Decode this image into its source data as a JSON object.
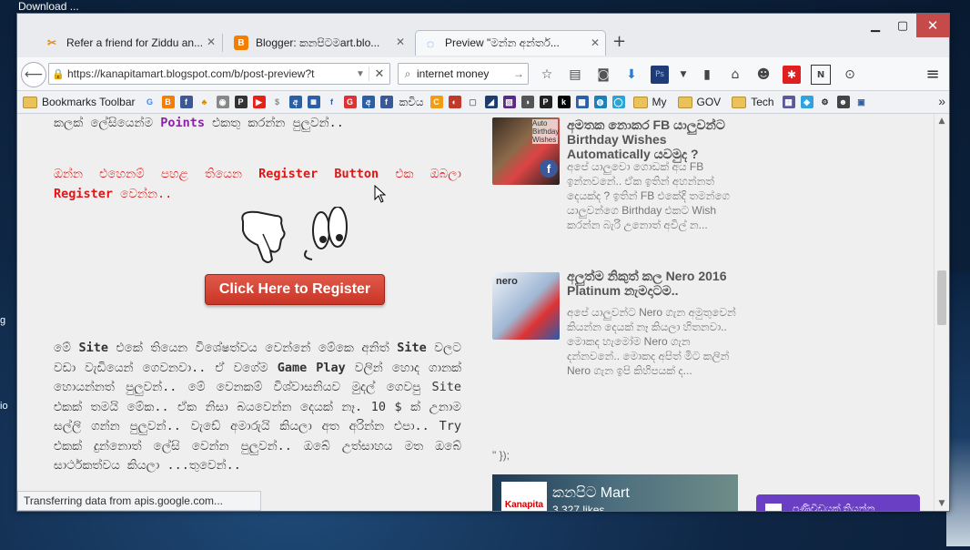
{
  "desktop": {
    "top_label": "Download ...",
    "side_labels": [
      "g",
      "io"
    ]
  },
  "tabs": [
    {
      "title": "Refer a friend for Ziddu an...",
      "icon": "ziddu-icon",
      "color": "#e28b1e",
      "active": false
    },
    {
      "title": "Blogger: කනපිටමart.blo...",
      "icon": "blogger-icon",
      "color": "#f57d00",
      "active": false
    },
    {
      "title": "Preview \"මන්න අන්තර්...",
      "icon": "loading-icon",
      "color": "#3a8be0",
      "active": true
    }
  ],
  "navbar": {
    "url": "https://kanapitamart.blogspot.com/b/post-preview?t",
    "search_value": "internet money"
  },
  "bookmarks": {
    "toolbar_label": "Bookmarks Toolbar",
    "text_items": [
      "කවිය",
      "My",
      "GOV",
      "Tech"
    ],
    "more": "»"
  },
  "post": {
    "line_points": "කලක් ලේසියෙන්ම ",
    "points_bold": "Points",
    "line_points_rest": " එකතු කරන්න පුලුවන්..",
    "red_line1_a": "ඔන්න එහෙනම් පහළ තියෙන ",
    "register_button_word": "Register Button",
    "red_line1_b": " එක ඔබලා ",
    "register_word": "Register",
    "red_line1_c": " වෙන්න..",
    "register_button_label": "Click Here to Register",
    "para_a": "මේ ",
    "site_bold": "Site",
    "para_b": " එකේ තියෙන විශේෂත්වය වෙන්නේ මේකෙ අනිත් ",
    "site_bold2": "Site",
    "para_c": " වලට වඩා වැඩියෙන් ගෙවනවා.. ඒ වගේම ",
    "game_play_bold": "Game Play",
    "para_d": " වලින් හොද ගානක් හොයන්නත් පුලුවන්.. මේ වෙනකම් විශ්වාසනියව මුදල් ගෙවපු Site එකක් තමයි මේක.. ඒක නිසා බයවෙන්න දෙයක් නෑ. 10 $ ක් උනාම සල්ලි ගන්න පුලුවන්.. වැඩේ අමාරුයි කියලා අත අරින්න එපා.. Try එකක් දුන්නොත් ලේසි වෙන්න පුලුවන්.. ඔබේ උත්සාහය මත ඔබේ සාර්ථකත්වය කියලා",
    "para_e": "...තුවෙන්.."
  },
  "sidebar": {
    "posts": [
      {
        "title": "අමතක නොකර FB යාලුවන්ට Birthday Wishes Automatically යවමුද ?",
        "excerpt": "අපේ යාලුවො ගොඩක් අය FB ඉන්නවනේ.. ඒක ඉතින් අහන්නත් දෙයක්ද ? ඉතින් FB එකේදි තමන්ගෙ යාලුවන්ගෙ Birthday එකට Wish කරන්න බැරි උනොත් අවිල් න...",
        "thumb_caption": "Auto Birthday Wishes"
      },
      {
        "title": "අලුත්ම නිකුත් කල Nero 2016 Platinum නැමදාටම..",
        "excerpt": "අපේ යාලුවන්ට Nero ගැන අමුතුවෙන් කියන්න දෙයක් නෑ කියලා හිතනවා.. මොකද හැමෝම Nero ගැන දන්නවනේ.. මොකද අපිත් මිට කලින් Nero ගැන ඉපි කිහිපයක් ද...",
        "thumb_caption": "nero"
      }
    ],
    "stray_text": "\" });",
    "fb_page_name": "කනපිට Mart",
    "fb_likes": "3,327 likes",
    "fb_thumb_text": "Kanapita"
  },
  "feedback_label": "පණිවිඩයක් තියන්න",
  "status_text": "Transferring data from apis.google.com..."
}
